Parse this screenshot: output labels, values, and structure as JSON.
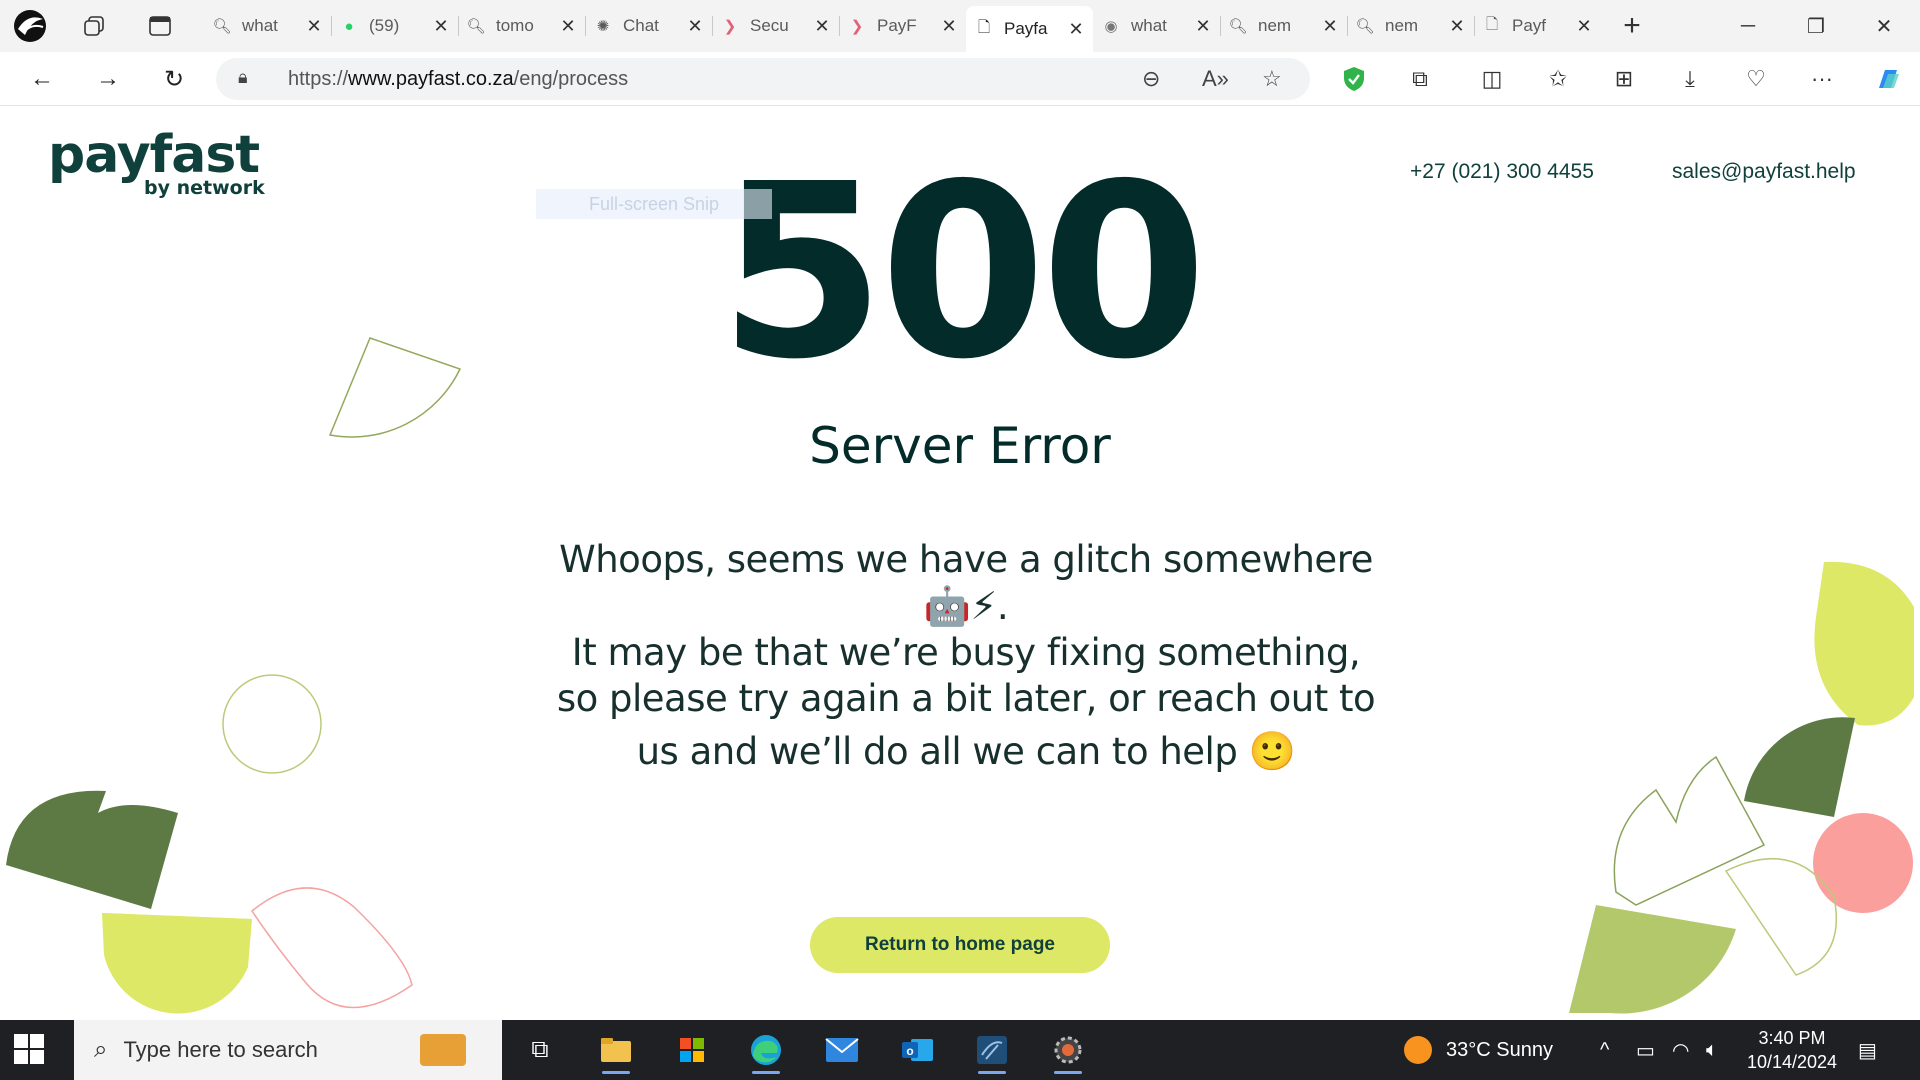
{
  "browser": {
    "tabs": [
      {
        "title": "what",
        "icon": "search-icon"
      },
      {
        "title": "(59)",
        "icon": "whatsapp-icon"
      },
      {
        "title": "tomo",
        "icon": "search-icon"
      },
      {
        "title": "Chat",
        "icon": "chatgpt-icon"
      },
      {
        "title": "Secu",
        "icon": "chevron-icon"
      },
      {
        "title": "PayF",
        "icon": "chevron-icon"
      },
      {
        "title": "Payfa",
        "icon": "page-icon",
        "active": true
      },
      {
        "title": "what",
        "icon": "globe-icon"
      },
      {
        "title": "nem",
        "icon": "search-icon"
      },
      {
        "title": "nem",
        "icon": "search-icon"
      },
      {
        "title": "Payf",
        "icon": "page-icon"
      }
    ],
    "url_prefix": "https://",
    "url_domain": "www.payfast.co.za",
    "url_path": "/eng/process"
  },
  "page": {
    "logo_brand": "payfast",
    "logo_sub": "by network",
    "phone": "+27 (021) 300 4455",
    "email": "sales@payfast.help",
    "snip_label": "Full-screen Snip",
    "error_code": "500",
    "error_title": "Server Error",
    "message_line1": "Whoops, seems we have a glitch somewhere",
    "message_emoji1": "🤖⚡.",
    "message_line2": "It may be that we’re busy fixing something,",
    "message_line3": "so please try again a bit later, or reach out to",
    "message_line4": "us and we’ll do all we can to help",
    "message_emoji2": "🙂",
    "return_button": "Return to home page",
    "colors": {
      "dark_green": "#032b2a",
      "lime": "#dde867",
      "moss": "#5d7a45",
      "pink": "#fa9f9c",
      "sage": "#b3c86a"
    }
  },
  "taskbar": {
    "search_placeholder": "Type here to search",
    "weather": "33°C  Sunny",
    "time": "3:40 PM",
    "date": "10/14/2024"
  }
}
